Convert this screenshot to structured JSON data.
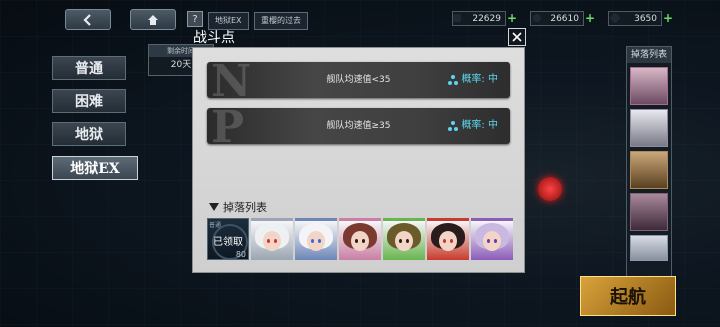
{
  "topbar": {
    "back_icon": "back-arrow-icon",
    "home_icon": "home-icon",
    "help_label": "?",
    "breadcrumb_1": "地狱EX",
    "breadcrumb_2": "重樱的过去",
    "resources": [
      {
        "icon": "oil-icon",
        "value": "22629"
      },
      {
        "icon": "coin-icon",
        "value": "26610"
      },
      {
        "icon": "gem-icon",
        "value": "3650"
      }
    ]
  },
  "difficulty": {
    "items": [
      "普通",
      "困难",
      "地狱",
      "地狱EX"
    ],
    "active_index": 3
  },
  "side_info": {
    "label": "剩余时间",
    "value": "20天"
  },
  "right_panel": {
    "title": "掉落列表"
  },
  "sortie_button": {
    "label": "起航"
  },
  "modal": {
    "title": "战斗点",
    "close_icon": "close-icon",
    "conditions": [
      {
        "letter": "N",
        "text": "舰队均速值<35",
        "rate": "概率: 中"
      },
      {
        "letter": "P",
        "text": "舰队均速值≥35",
        "rate": "概率: 中"
      }
    ],
    "drop_title": "掉落列表",
    "obtained_card": {
      "tag": "普通",
      "label": "已领取",
      "count": "80"
    },
    "drop_cards": [
      {
        "hair": "#eef1f4",
        "accent": "#9aa6b2",
        "eye": "#c33"
      },
      {
        "hair": "#f4f4f8",
        "accent": "#6c86b6",
        "eye": "#3a6ad0"
      },
      {
        "hair": "#7b3a2f",
        "accent": "#c97fa3",
        "eye": "#2d1a14"
      },
      {
        "hair": "#6b5a2a",
        "accent": "#68b54f",
        "eye": "#2d1a14"
      },
      {
        "hair": "#2a1c1a",
        "accent": "#c73b2d",
        "eye": "#c33"
      },
      {
        "hair": "#c9b8e0",
        "accent": "#8b5cb8",
        "eye": "#6a3aa0"
      }
    ]
  },
  "colors": {
    "rate_text": "#59d8ef",
    "sortie": "#d9a23a",
    "enemy_node": "#ff4444"
  }
}
